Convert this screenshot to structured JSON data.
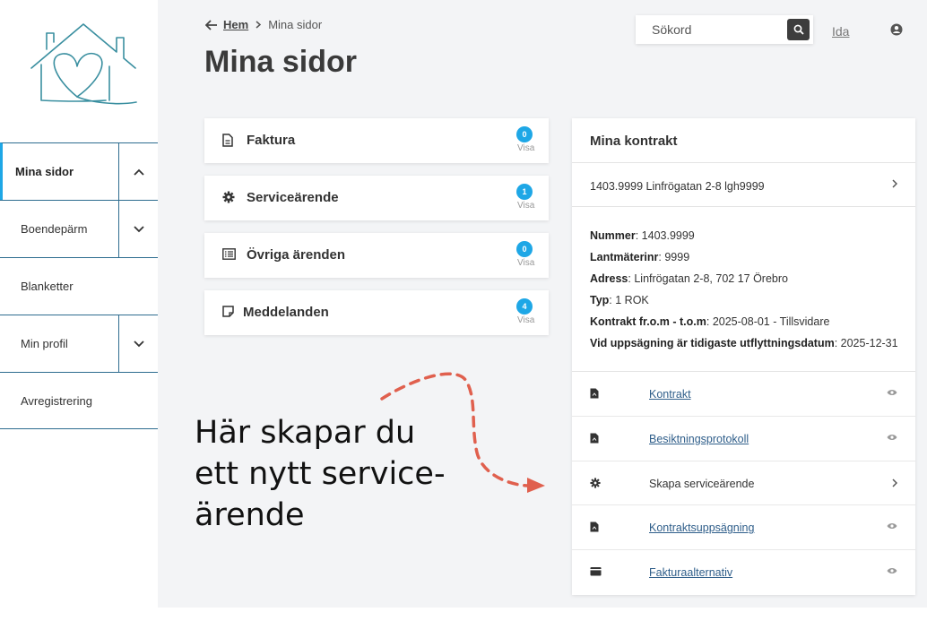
{
  "sidebar": {
    "items": [
      {
        "label": "Mina sidor",
        "active": true,
        "toggle": "chevron-up"
      },
      {
        "label": "Boendepärm",
        "toggle": "chevron-down"
      },
      {
        "label": "Blanketter"
      },
      {
        "label": "Min profil",
        "toggle": "chevron-down"
      },
      {
        "label": "Avregistrering"
      }
    ]
  },
  "header": {
    "breadcrumb": {
      "home": "Hem",
      "current": "Mina sidor"
    },
    "title": "Mina sidor",
    "search_placeholder": "Sökord",
    "user": "Ida"
  },
  "cards": [
    {
      "title": "Faktura",
      "count": "0",
      "action": "Visa",
      "icon": "document-icon"
    },
    {
      "title": "Serviceärende",
      "count": "1",
      "action": "Visa",
      "icon": "gear-icon"
    },
    {
      "title": "Övriga ärenden",
      "count": "0",
      "action": "Visa",
      "icon": "list-icon"
    },
    {
      "title": "Meddelanden",
      "count": "4",
      "action": "Visa",
      "icon": "note-icon"
    }
  ],
  "contracts": {
    "title": "Mina kontrakt",
    "selected": "1403.9999 Linfrögatan 2-8 lgh9999",
    "details": [
      {
        "label": "Nummer",
        "value": ": 1403.9999"
      },
      {
        "label": "Lantmäterinr",
        "value": ": 9999"
      },
      {
        "label": "Adress",
        "value": ": Linfrögatan 2-8, 702 17 Örebro"
      },
      {
        "label": "Typ",
        "value": ": 1 ROK"
      },
      {
        "label": "Kontrakt fr.o.m - t.o.m",
        "value": ": 2025-08-01 - Tillsvidare"
      },
      {
        "label": "Vid uppsägning är tidigaste utflyttningsdatum",
        "value": ": 2025-12-31"
      }
    ],
    "documents": [
      {
        "label": "Kontrakt",
        "icon": "pdf-icon",
        "action": "eye-icon"
      },
      {
        "label": "Besiktningsprotokoll",
        "icon": "pdf-icon",
        "action": "eye-icon"
      },
      {
        "label": "Skapa serviceärende",
        "icon": "gear-icon",
        "action": "chevron-right-icon"
      },
      {
        "label": "Kontraktsuppsägning",
        "icon": "pdf-icon",
        "action": "eye-icon"
      },
      {
        "label": "Fakturaalternativ",
        "icon": "wallet-icon",
        "action": "eye-icon"
      }
    ]
  },
  "annotation": {
    "line1": "Här skapar du",
    "line2": "ett nytt service-",
    "line3": "ärende"
  },
  "colors": {
    "accent": "#1ea7e6",
    "nav_border": "#2d6c8f",
    "logo": "#3a8fa0",
    "arrow": "#e0604e"
  }
}
